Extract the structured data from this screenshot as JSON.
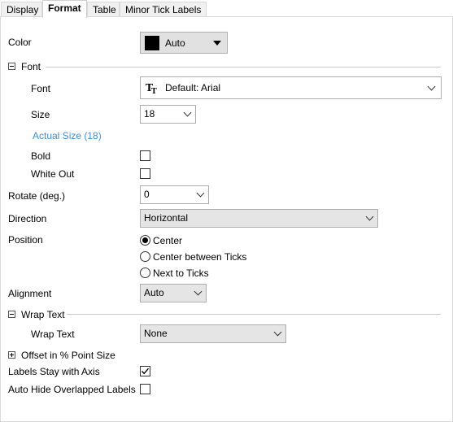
{
  "tabs": [
    "Display",
    "Format",
    "Table",
    "Minor Tick Labels"
  ],
  "color": {
    "label": "Color",
    "value": "Auto",
    "swatch": "#000000"
  },
  "font_group": {
    "title": "Font",
    "font_label": "Font",
    "font_value": "Default: Arial",
    "size_label": "Size",
    "size_value": "18",
    "actual_size": "Actual Size (18)",
    "bold_label": "Bold",
    "bold_checked": false,
    "whiteout_label": "White Out",
    "whiteout_checked": false
  },
  "rotate": {
    "label": "Rotate (deg.)",
    "value": "0"
  },
  "direction": {
    "label": "Direction",
    "value": "Horizontal"
  },
  "position": {
    "label": "Position",
    "options": [
      "Center",
      "Center between Ticks",
      "Next to Ticks"
    ],
    "selected": "Center"
  },
  "alignment": {
    "label": "Alignment",
    "value": "Auto"
  },
  "wrap_group": {
    "title": "Wrap Text",
    "label": "Wrap Text",
    "value": "None"
  },
  "offset_group": {
    "title": "Offset in % Point Size"
  },
  "labels_stay": {
    "label": "Labels Stay with Axis",
    "checked": true
  },
  "auto_hide": {
    "label": "Auto Hide Overlapped Labels",
    "checked": false
  },
  "accent_color": "#3a8ee6"
}
